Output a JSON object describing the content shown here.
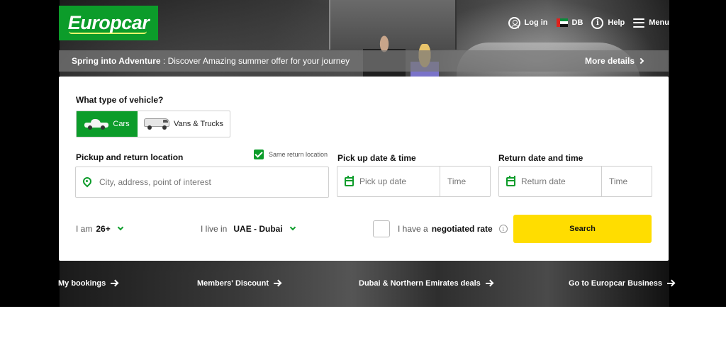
{
  "brand": {
    "logo_text": "Europcar",
    "color": "#0c9c2a",
    "accent_color": "#ffdd00"
  },
  "topnav": {
    "login_label": "Log in",
    "country_code": "DB",
    "help_label": "Help",
    "menu_label": "Menu",
    "icons": [
      "user-icon",
      "uae-flag-icon",
      "info-icon",
      "hamburger-menu-icon"
    ]
  },
  "promo": {
    "title": "Spring into Adventure",
    "separator": " : ",
    "text": "Discover Amazing summer offer for your journey",
    "more_label": "More details"
  },
  "search": {
    "vehicle_question": "What type of vehicle?",
    "vehicle_types": [
      {
        "label": "Cars",
        "icon": "car-icon",
        "selected": true
      },
      {
        "label": "Vans & Trucks",
        "icon": "van-icon",
        "selected": false
      }
    ],
    "location_label": "Pickup and return location",
    "same_return_label": "Same return location",
    "same_return_checked": true,
    "location_placeholder": "City, address, point of interest",
    "pickup_label": "Pick up date & time",
    "pickup_date_placeholder": "Pick up date",
    "pickup_time_placeholder": "Time",
    "return_label": "Return date and time",
    "return_date_placeholder": "Return date",
    "return_time_placeholder": "Time",
    "age_prefix": "I am",
    "age_value": "26+",
    "residence_prefix": "I live in",
    "residence_value": "UAE - Dubai",
    "negotiated_prefix": "I have a",
    "negotiated_bold": "negotiated rate",
    "negotiated_checked": false,
    "search_label": "Search"
  },
  "footer_links": [
    {
      "label": "My bookings"
    },
    {
      "label": "Members' Discount"
    },
    {
      "label": "Dubai & Northern Emirates deals"
    },
    {
      "label": "Go to Europcar Business"
    }
  ]
}
